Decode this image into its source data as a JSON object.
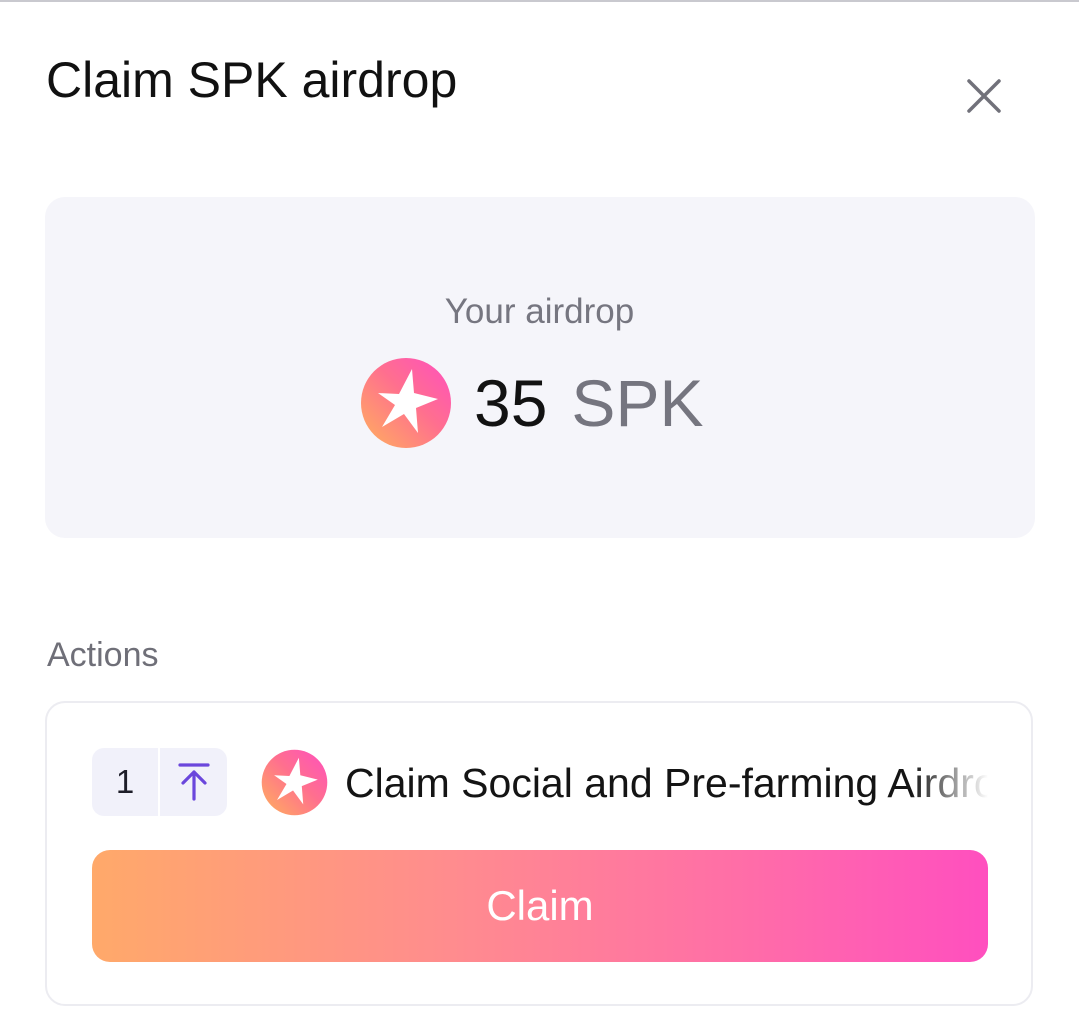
{
  "modal": {
    "title": "Claim SPK airdrop",
    "close_icon": "close-icon"
  },
  "airdrop": {
    "label": "Your airdrop",
    "amount": "35",
    "unit": "SPK",
    "token_icon": "spark-token-icon"
  },
  "actions": {
    "heading": "Actions",
    "items": [
      {
        "step": "1",
        "step_icon": "arrow-up-to-line-icon",
        "token_icon": "spark-token-icon",
        "title": "Claim Social and Pre-farming Airdrop",
        "button_label": "Claim"
      }
    ]
  },
  "colors": {
    "accent_orange": "#ffa96a",
    "accent_pink": "#ff4fbf",
    "step_icon": "#6b47dc",
    "muted_text": "#75757f"
  }
}
